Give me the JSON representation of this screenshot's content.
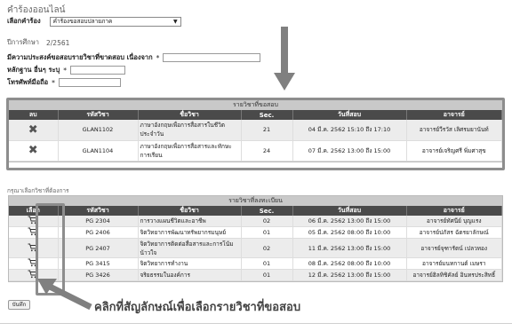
{
  "header": {
    "title": "คำร้องออนไลน์",
    "select_label": "เลือกคำร้อง",
    "select_value": "คำร้องขอสอบปลายภาค"
  },
  "form": {
    "year_label": "ปีการศึกษา",
    "year_value": "2/2561",
    "reason_label": "มีความประสงค์ขอสอบรายวิชาที่ขาดสอบ เนื่องจาก",
    "evidence_label": "หลักฐาน อื่นๆ ระบุ",
    "phone_label": "โทรศัพท์มือถือ",
    "required_mark": "*"
  },
  "exam_table": {
    "title": "รายวิชาที่ขอสอบ",
    "headers": [
      "ลบ",
      "รหัสวิชา",
      "ชื่อวิชา",
      "Sec.",
      "วันที่สอบ",
      "อาจารย์"
    ],
    "rows": [
      {
        "code": "GLAN1102",
        "name": "ภาษาอังกฤษเพื่อการสื่อสารในชีวิตประจำวัน",
        "sec": "21",
        "date": "04 มี.ค. 2562 15:10 ถึง 17:10",
        "teacher": "อาจารย์วีรวัส เลิศรมยานันท์"
      },
      {
        "code": "GLAN1104",
        "name": "ภาษาอังกฤษเพื่อการสื่อสารและทักษะการเรียน",
        "sec": "24",
        "date": "07 มี.ค. 2562 13:00 ถึง 15:00",
        "teacher": "อาจารย์เจริญศรี พิ่มศาสุข"
      }
    ]
  },
  "section_note": "กรุณาเลือกวิชาที่ต้องการ",
  "reg_table": {
    "title": "รายวิชาที่ลงทะเบียน",
    "headers": [
      "เลือก",
      "รหัสวิชา",
      "ชื่อวิชา",
      "Sec.",
      "วันที่สอบ",
      "อาจารย์"
    ],
    "rows": [
      {
        "code": "PG 2304",
        "name": "การวางแผนชีวิตและอาชีพ",
        "sec": "02",
        "date": "06 มี.ค. 2562 13:00 ถึง 15:00",
        "teacher": "อาจารย์ทัศนีย์ บุญแรง"
      },
      {
        "code": "PG 2406",
        "name": "จิตวิทยาการพัฒนาทรัพยากรมนุษย์",
        "sec": "01",
        "date": "05 มี.ค. 2562 08:00 ถึง 10:00",
        "teacher": "อาจารย์ปภัสร ฉัตรยาลักษณ์"
      },
      {
        "code": "PG 2407",
        "name": "จิตวิทยาการติดต่อสื่อสารและการโน้มน้าวใจ",
        "sec": "02",
        "date": "11 มี.ค. 2562 13:00 ถึง 15:00",
        "teacher": "อาจารย์จุฑารัตน์ เปลวทอง"
      },
      {
        "code": "PG 3415",
        "name": "จิตวิทยาการทำงาน",
        "sec": "01",
        "date": "08 มี.ค. 2562 08:00 ถึง 10:00",
        "teacher": "อาจารย์มนทกานต์ เมษรา"
      },
      {
        "code": "PG 3426",
        "name": "จริยธรรมในองค์การ",
        "sec": "01",
        "date": "12 มี.ค. 2562 13:00 ถึง 15:00",
        "teacher": "อาจารย์ฮิลทิชิคัลย์ อินทรประสิทธิ์"
      }
    ]
  },
  "submit_label": "บันทึก",
  "callout_text": "คลิกที่สัญลักษณ์เพื่อเลือกรายวิชาที่ขอสอบ",
  "icons": {
    "delete": "x-icon",
    "select": "cart-icon",
    "arrow": "arrow-down-icon"
  }
}
